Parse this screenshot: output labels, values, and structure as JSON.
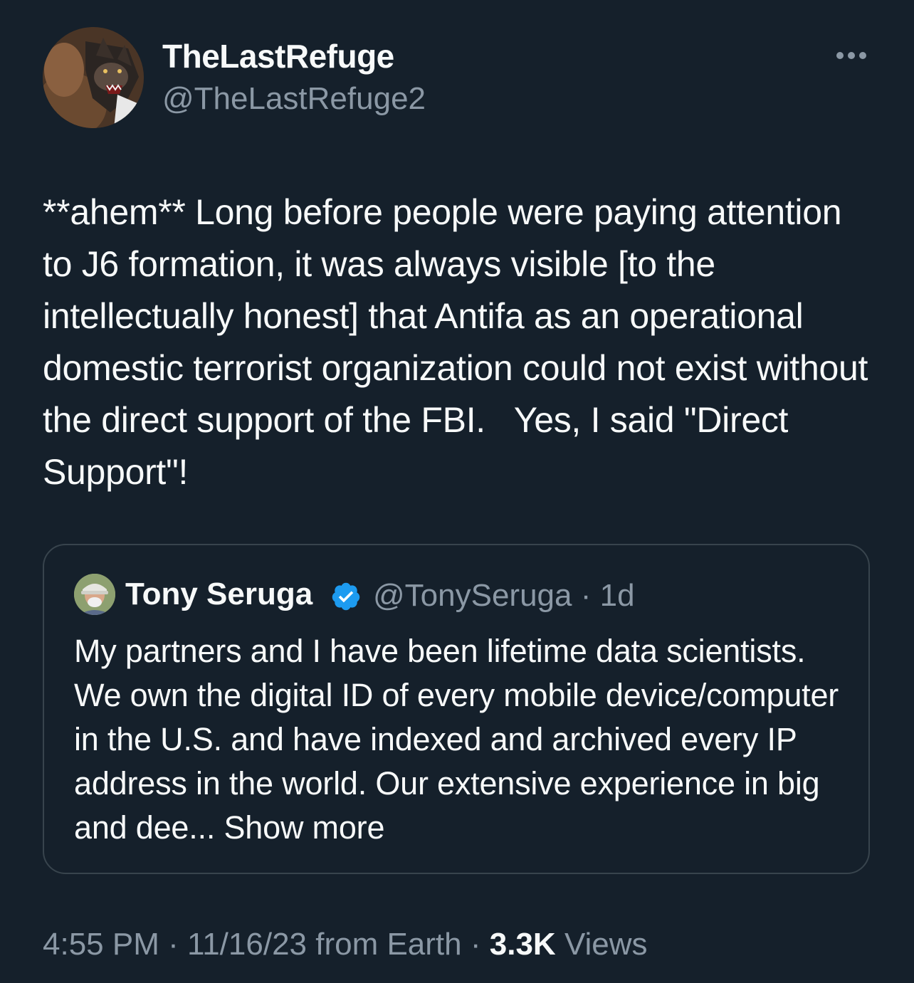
{
  "author": {
    "display_name": "TheLastRefuge",
    "handle": "@TheLastRefuge2",
    "avatar_icon": "wolf-avatar"
  },
  "more_icon": "ellipsis-icon",
  "tweet": {
    "text": "**ahem** Long before people were paying attention to J6 formation, it was always visible [to the intellectually honest] that Antifa as an operational domestic terrorist organization could not exist without the direct support of the FBI.   Yes, I said \"Direct Support\"!"
  },
  "quote": {
    "display_name": "Tony Seruga",
    "verified_icon": "verified-badge-icon",
    "verified_color": "#1d9bf0",
    "handle": "@TonySeruga",
    "separator": "·",
    "age": "1d",
    "text": "My partners and I have been lifetime data scientists. We own the digital ID of every mobile device/computer in the U.S. and have indexed and archived every IP address in the world. Our extensive experience in big and dee...",
    "show_more": "Show more"
  },
  "meta": {
    "time": "4:55 PM",
    "separator": "·",
    "date": "11/16/23 from Earth",
    "views_count": "3.3K",
    "views_label": "Views"
  },
  "colors": {
    "background": "#15202b",
    "text_primary": "#f7f9f9",
    "text_secondary": "#8b98a5",
    "border": "#38444d"
  }
}
